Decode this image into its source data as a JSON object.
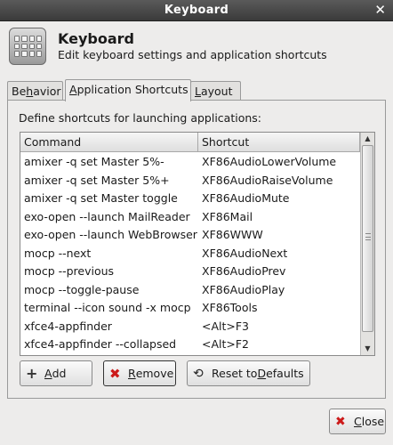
{
  "window": {
    "title": "Keyboard",
    "close_glyph": "✕"
  },
  "header": {
    "title": "Keyboard",
    "subtitle": "Edit keyboard settings and application shortcuts"
  },
  "tabs": [
    {
      "pre": "Be",
      "u": "h",
      "post": "avior"
    },
    {
      "pre": "",
      "u": "A",
      "post": "pplication Shortcuts"
    },
    {
      "pre": "",
      "u": "L",
      "post": "ayout"
    }
  ],
  "panel": {
    "description": "Define shortcuts for launching applications:",
    "columns": {
      "command": "Command",
      "shortcut": "Shortcut"
    },
    "rows": [
      {
        "command": "amixer -q set Master 5%-",
        "shortcut": "XF86AudioLowerVolume"
      },
      {
        "command": "amixer -q set Master 5%+",
        "shortcut": "XF86AudioRaiseVolume"
      },
      {
        "command": "amixer -q set Master toggle",
        "shortcut": "XF86AudioMute"
      },
      {
        "command": "exo-open --launch MailReader",
        "shortcut": "XF86Mail"
      },
      {
        "command": "exo-open --launch WebBrowser",
        "shortcut": "XF86WWW"
      },
      {
        "command": "mocp --next",
        "shortcut": "XF86AudioNext"
      },
      {
        "command": "mocp --previous",
        "shortcut": "XF86AudioPrev"
      },
      {
        "command": "mocp --toggle-pause",
        "shortcut": "XF86AudioPlay"
      },
      {
        "command": "terminal --icon sound -x mocp",
        "shortcut": "XF86Tools"
      },
      {
        "command": "xfce4-appfinder",
        "shortcut": "<Alt>F3"
      },
      {
        "command": "xfce4-appfinder --collapsed",
        "shortcut": "<Alt>F2"
      }
    ],
    "buttons": {
      "add": {
        "pre": "",
        "u": "A",
        "post": "dd"
      },
      "remove": {
        "pre": "",
        "u": "R",
        "post": "emove"
      },
      "reset": {
        "pre": "Reset to ",
        "u": "D",
        "post": "efaults"
      }
    }
  },
  "footer": {
    "close": {
      "pre": "",
      "u": "C",
      "post": "lose"
    }
  },
  "icons": {
    "window_close": "close-icon",
    "app": "keyboard-icon",
    "add": "plus-icon",
    "remove": "remove-x-icon",
    "reset": "reset-icon",
    "close": "close-icon"
  },
  "colors": {
    "titlebar": "#3a3a3a",
    "remove_icon": "#cc1a1a"
  }
}
